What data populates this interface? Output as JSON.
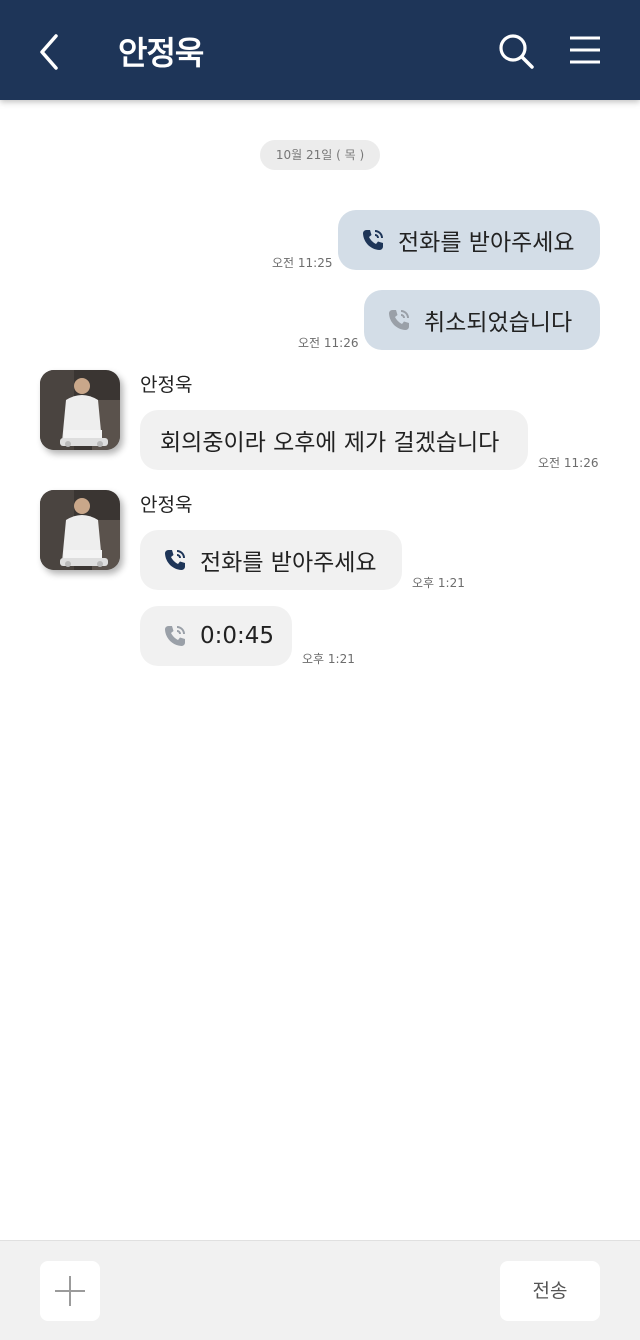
{
  "header": {
    "title": "안정욱",
    "background": "#1e3558"
  },
  "date_separator": "10월 21일 ( 목 )",
  "messages": [
    {
      "direction": "outgoing",
      "icon": "phone-call-dark-icon",
      "text": "전화를 받아주세요",
      "time": "오전 11:25"
    },
    {
      "direction": "outgoing",
      "icon": "phone-call-gray-icon",
      "text": "취소되었습니다",
      "time": "오전 11:26"
    },
    {
      "direction": "incoming",
      "sender": "안정욱",
      "text": "회의중이라 오후에 제가 걸겠습니다",
      "time": "오전 11:26"
    },
    {
      "direction": "incoming",
      "sender": "안정욱",
      "icon": "phone-call-dark-icon",
      "text": "전화를 받아주세요",
      "time": "오후 1:21"
    },
    {
      "direction": "incoming",
      "icon": "phone-call-gray-icon",
      "text": "0:0:45",
      "time": "오후 1:21"
    }
  ],
  "footer": {
    "attach_icon": "plus-icon",
    "send_label": "전송"
  },
  "colors": {
    "outgoing_bubble": "#d3dde7",
    "incoming_bubble": "#f1f1f1",
    "accent_dark": "#1e3558"
  }
}
